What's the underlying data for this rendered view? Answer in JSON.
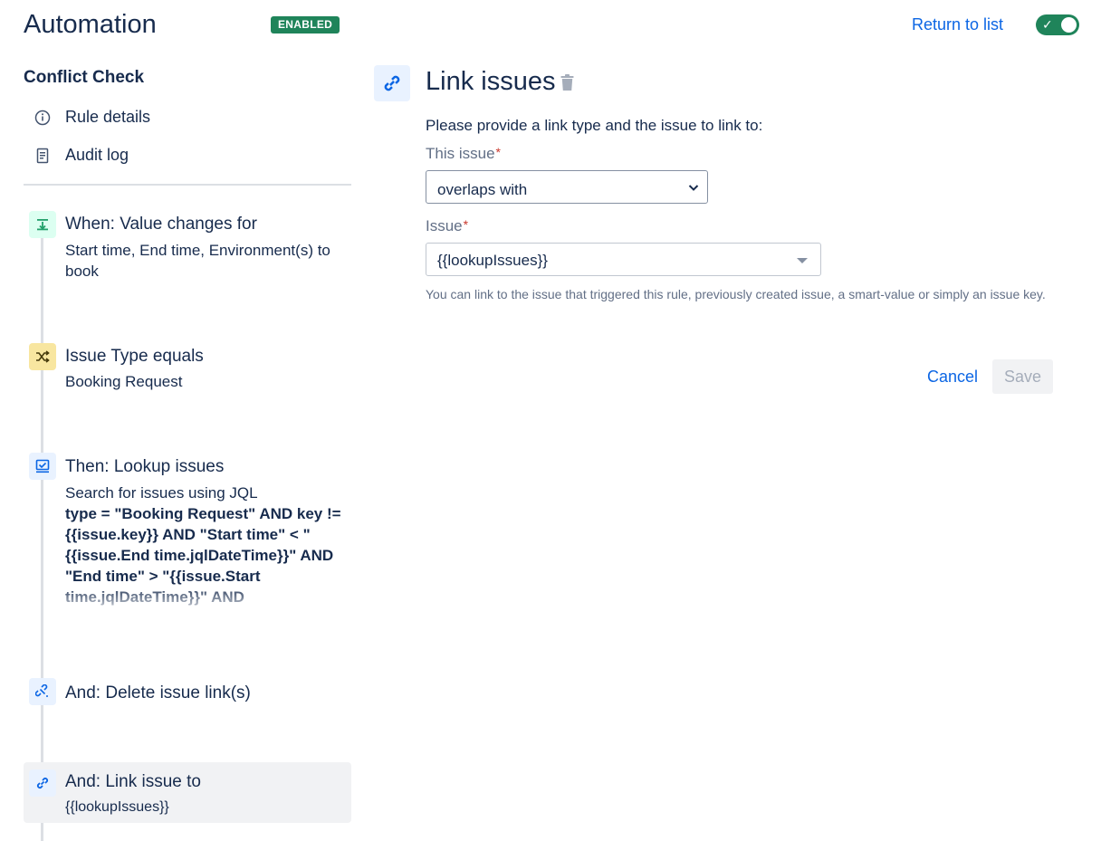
{
  "header": {
    "title": "Automation",
    "status_badge": "ENABLED",
    "return_link": "Return to list",
    "toggle_on": true
  },
  "sidebar": {
    "rule_name": "Conflict Check",
    "nav": [
      {
        "label": "Rule details",
        "icon": "info-icon"
      },
      {
        "label": "Audit log",
        "icon": "document-icon"
      }
    ]
  },
  "steps": [
    {
      "type": "trigger",
      "icon": "trigger-icon",
      "icon_color": "#22A06B",
      "icon_bg": "#DCFFF1",
      "title": "When: Value changes for",
      "subtitle": "Start time, End time, Environment(s) to book"
    },
    {
      "type": "condition",
      "icon": "shuffle-icon",
      "icon_color": "#7F5F01",
      "icon_bg": "#F8E6A0",
      "title": "Issue Type equals",
      "subtitle": "Booking Request"
    },
    {
      "type": "action",
      "icon": "lookup-icon",
      "icon_color": "#0C66E4",
      "icon_bg": "#E9F2FF",
      "title": "Then: Lookup issues",
      "subtitle": "Search for issues using JQL",
      "jql": "type = \"Booking Request\" AND key != {{issue.key}} AND \"Start time\" < \"{{issue.End time.jqlDateTime}}\" AND \"End time\" > \"{{issue.Start time.jqlDateTime}}\" AND \"Environment(s) to book\" IN"
    },
    {
      "type": "action",
      "icon": "unlink-icon",
      "icon_color": "#0C66E4",
      "icon_bg": "#E9F2FF",
      "title": "And: Delete issue link(s)"
    },
    {
      "type": "action",
      "icon": "link-icon",
      "icon_color": "#0C66E4",
      "icon_bg": "#E9F2FF",
      "title": "And: Link issue to",
      "subtitle": "{{lookupIssues}}",
      "selected": true
    }
  ],
  "detail": {
    "title": "Link issues",
    "prompt": "Please provide a link type and the issue to link to:",
    "this_issue_label": "This issue",
    "link_type_value": "overlaps with",
    "issue_label": "Issue",
    "issue_value": "{{lookupIssues}}",
    "required_mark": "*",
    "helper": "You can link to the issue that triggered this rule, previously created issue, a smart-value or simply an issue key.",
    "cancel_label": "Cancel",
    "save_label": "Save"
  }
}
